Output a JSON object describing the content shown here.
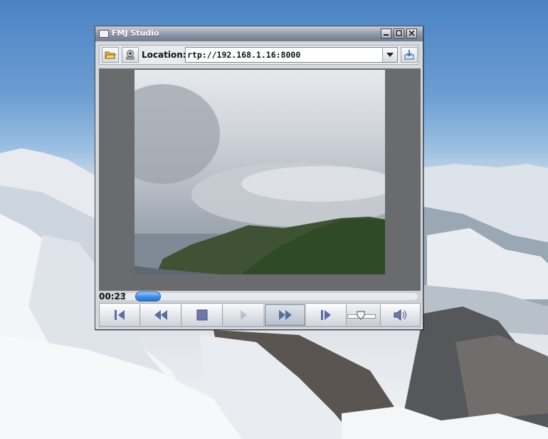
{
  "window": {
    "title": "FMJ Studio",
    "icon": "window-icon",
    "controls": [
      "minimize-icon",
      "maximize-icon",
      "close-icon"
    ]
  },
  "toolbar": {
    "open_icon": "folder-open-icon",
    "capture_icon": "webcam-icon",
    "location_label": "Location:",
    "location_value": "rtp://192.168.1.16:8000",
    "dropdown_icon": "chevron-down-icon",
    "go_icon": "load-url-icon"
  },
  "playback": {
    "time": "00:23",
    "progress_fraction": 0.04,
    "volume_fraction": 0.4
  },
  "controls": [
    {
      "name": "step-back-button",
      "icon": "step-back-icon",
      "enabled": true
    },
    {
      "name": "rewind-button",
      "icon": "rewind-icon",
      "enabled": true
    },
    {
      "name": "stop-button",
      "icon": "stop-icon",
      "enabled": true
    },
    {
      "name": "play-button",
      "icon": "play-icon",
      "enabled": false
    },
    {
      "name": "fast-forward-button",
      "icon": "fast-forward-icon",
      "enabled": true,
      "active": true
    },
    {
      "name": "step-forward-button",
      "icon": "step-forward-icon",
      "enabled": true
    }
  ],
  "colors": {
    "accent": "#3c8dea",
    "video_background": "#6a6b6e"
  }
}
